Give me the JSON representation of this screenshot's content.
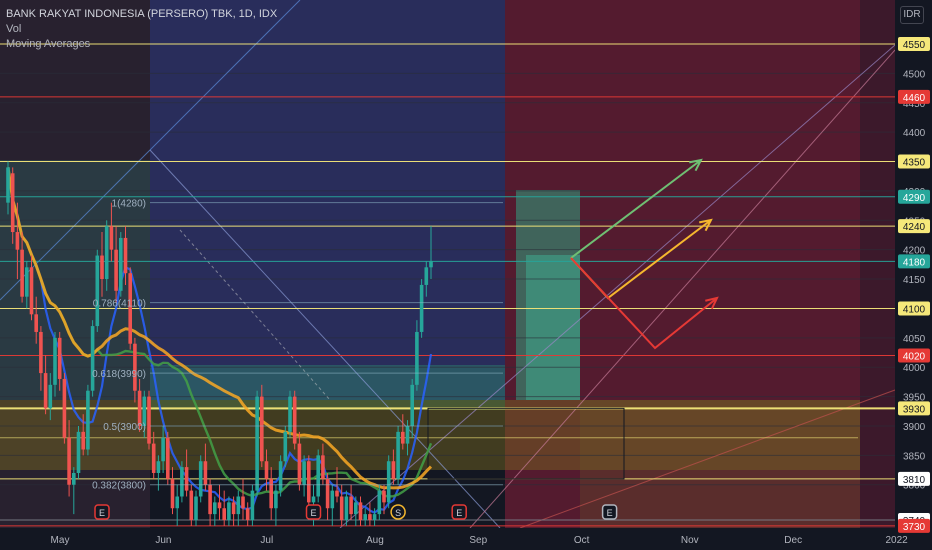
{
  "legend": {
    "symbol": "BANK RAKYAT INDONESIA (PERSERO) TBK, 1D, IDX",
    "indicator_1": "Vol",
    "indicator_2": "Moving Averages"
  },
  "currency": "IDR",
  "chart_data": {
    "type": "candlestick",
    "y_range": [
      3730,
      4610
    ],
    "y_ticks": [
      3800,
      3850,
      3900,
      3950,
      4000,
      4050,
      4100,
      4150,
      4200,
      4250,
      4300,
      4350,
      4400,
      4450,
      4500
    ],
    "x_labels": [
      {
        "label": "May",
        "x": 0
      },
      {
        "label": "Jun",
        "x": 22
      },
      {
        "label": "Jul",
        "x": 44
      },
      {
        "label": "Aug",
        "x": 67
      },
      {
        "label": "Sep",
        "x": 89
      },
      {
        "label": "Oct",
        "x": 111
      },
      {
        "label": "Nov",
        "x": 134
      },
      {
        "label": "Dec",
        "x": 156
      },
      {
        "label": "2022",
        "x": 178
      }
    ],
    "candles": [
      [
        4280,
        4350,
        4260,
        4340
      ],
      [
        4330,
        4340,
        4210,
        4230
      ],
      [
        4230,
        4280,
        4150,
        4200
      ],
      [
        4200,
        4230,
        4110,
        4120
      ],
      [
        4120,
        4180,
        4100,
        4170
      ],
      [
        4170,
        4190,
        4080,
        4090
      ],
      [
        4090,
        4120,
        4040,
        4060
      ],
      [
        4060,
        4070,
        3960,
        3990
      ],
      [
        3990,
        4020,
        3920,
        3930
      ],
      [
        3930,
        3990,
        3910,
        3970
      ],
      [
        3970,
        4060,
        3950,
        4050
      ],
      [
        4050,
        4060,
        3960,
        3980
      ],
      [
        3980,
        3990,
        3870,
        3880
      ],
      [
        3880,
        3910,
        3780,
        3800
      ],
      [
        3800,
        3830,
        3750,
        3820
      ],
      [
        3820,
        3900,
        3810,
        3890
      ],
      [
        3890,
        3920,
        3850,
        3860
      ],
      [
        3860,
        3970,
        3850,
        3960
      ],
      [
        3960,
        4080,
        3950,
        4070
      ],
      [
        4070,
        4200,
        4060,
        4190
      ],
      [
        4190,
        4230,
        4120,
        4150
      ],
      [
        4150,
        4250,
        4130,
        4240
      ],
      [
        4240,
        4280,
        4180,
        4200
      ],
      [
        4200,
        4240,
        4110,
        4130
      ],
      [
        4130,
        4230,
        4120,
        4220
      ],
      [
        4220,
        4240,
        4140,
        4160
      ],
      [
        4160,
        4170,
        4030,
        4040
      ],
      [
        4040,
        4050,
        3940,
        3960
      ],
      [
        3960,
        3980,
        3890,
        3900
      ],
      [
        3900,
        3960,
        3880,
        3950
      ],
      [
        3950,
        3960,
        3860,
        3870
      ],
      [
        3870,
        3890,
        3810,
        3820
      ],
      [
        3820,
        3850,
        3790,
        3840
      ],
      [
        3840,
        3900,
        3820,
        3880
      ],
      [
        3880,
        3890,
        3800,
        3810
      ],
      [
        3810,
        3830,
        3750,
        3760
      ],
      [
        3760,
        3800,
        3730,
        3780
      ],
      [
        3780,
        3840,
        3770,
        3830
      ],
      [
        3830,
        3860,
        3780,
        3790
      ],
      [
        3790,
        3800,
        3730,
        3740
      ],
      [
        3740,
        3790,
        3730,
        3780
      ],
      [
        3780,
        3850,
        3770,
        3840
      ],
      [
        3840,
        3870,
        3790,
        3800
      ],
      [
        3800,
        3810,
        3730,
        3750
      ],
      [
        3750,
        3780,
        3730,
        3770
      ],
      [
        3770,
        3800,
        3740,
        3760
      ],
      [
        3760,
        3790,
        3730,
        3740
      ],
      [
        3740,
        3780,
        3730,
        3770
      ],
      [
        3770,
        3780,
        3730,
        3750
      ],
      [
        3750,
        3790,
        3730,
        3780
      ],
      [
        3780,
        3810,
        3740,
        3760
      ],
      [
        3760,
        3770,
        3730,
        3740
      ],
      [
        3740,
        3800,
        3730,
        3790
      ],
      [
        3790,
        3960,
        3780,
        3950
      ],
      [
        3950,
        3970,
        3830,
        3840
      ],
      [
        3840,
        3860,
        3790,
        3810
      ],
      [
        3810,
        3830,
        3740,
        3760
      ],
      [
        3760,
        3800,
        3730,
        3790
      ],
      [
        3790,
        3850,
        3780,
        3840
      ],
      [
        3840,
        3900,
        3830,
        3890
      ],
      [
        3890,
        3960,
        3880,
        3950
      ],
      [
        3950,
        3960,
        3860,
        3870
      ],
      [
        3870,
        3890,
        3790,
        3800
      ],
      [
        3800,
        3850,
        3780,
        3840
      ],
      [
        3840,
        3850,
        3760,
        3770
      ],
      [
        3770,
        3800,
        3730,
        3780
      ],
      [
        3780,
        3860,
        3770,
        3850
      ],
      [
        3850,
        3870,
        3800,
        3810
      ],
      [
        3810,
        3820,
        3740,
        3760
      ],
      [
        3760,
        3800,
        3730,
        3790
      ],
      [
        3790,
        3830,
        3770,
        3780
      ],
      [
        3780,
        3800,
        3730,
        3740
      ],
      [
        3740,
        3790,
        3730,
        3780
      ],
      [
        3780,
        3800,
        3740,
        3750
      ],
      [
        3750,
        3780,
        3730,
        3770
      ],
      [
        3770,
        3780,
        3730,
        3740
      ],
      [
        3740,
        3760,
        3730,
        3750
      ],
      [
        3750,
        3770,
        3730,
        3740
      ],
      [
        3740,
        3760,
        3730,
        3750
      ],
      [
        3750,
        3800,
        3740,
        3790
      ],
      [
        3790,
        3800,
        3750,
        3770
      ],
      [
        3770,
        3850,
        3760,
        3840
      ],
      [
        3840,
        3860,
        3800,
        3810
      ],
      [
        3810,
        3900,
        3800,
        3890
      ],
      [
        3890,
        3920,
        3860,
        3870
      ],
      [
        3870,
        3910,
        3850,
        3900
      ],
      [
        3900,
        3980,
        3880,
        3970
      ],
      [
        3970,
        4080,
        3960,
        4060
      ],
      [
        4060,
        4150,
        4050,
        4140
      ],
      [
        4140,
        4180,
        4120,
        4170
      ],
      [
        4170,
        4240,
        4150,
        4180
      ]
    ],
    "levels": [
      {
        "price": 4550,
        "color": "#f5e87a",
        "label": "4550",
        "label_bg": "#f5e87a",
        "label_fg": "#131722"
      },
      {
        "price": 4460,
        "color": "#e53935",
        "label": "4460",
        "label_bg": "#e53935",
        "label_fg": "#ffffff"
      },
      {
        "price": 4350,
        "color": "#f5e87a",
        "label": "4350",
        "label_bg": "#f5e87a",
        "label_fg": "#131722"
      },
      {
        "price": 4290,
        "color": "#26a69a",
        "label": "4290",
        "label_bg": "#26a69a",
        "label_fg": "#ffffff"
      },
      {
        "price": 4240,
        "color": "#f5e87a",
        "label": "4240",
        "label_bg": "#f5e87a",
        "label_fg": "#131722"
      },
      {
        "price": 4180,
        "color": "#26a69a",
        "label": "4180",
        "label_bg": "#26a69a",
        "label_fg": "#ffffff"
      },
      {
        "price": 4100,
        "color": "#f5e87a",
        "label": "4100",
        "label_bg": "#f5e87a",
        "label_fg": "#131722"
      },
      {
        "price": 4020,
        "color": "#e53935",
        "label": "4020",
        "label_bg": "#e53935",
        "label_fg": "#ffffff"
      },
      {
        "price": 3930,
        "color": "#f5e87a",
        "label": "3930",
        "label_bg": "#f5e87a",
        "label_fg": "#131722"
      },
      {
        "price": 3810,
        "color": "#f5e87a",
        "label": "3810",
        "label_bg": "#ffffff",
        "label_fg": "#131722"
      },
      {
        "price": 3740,
        "color": "#787b86",
        "label": "3740",
        "label_bg": "#ffffff",
        "label_fg": "#131722"
      },
      {
        "price": 3730,
        "color": "#e53935",
        "label": "3730",
        "label_bg": "#e53935",
        "label_fg": "#ffffff"
      }
    ],
    "fib_levels": [
      {
        "text": "1(4280)",
        "price": 4280
      },
      {
        "text": "0.786(4110)",
        "price": 4110
      },
      {
        "text": "0.618(3990)",
        "price": 3990
      },
      {
        "text": "0.5(3900)",
        "price": 3900
      },
      {
        "text": "0.382(3800)",
        "price": 3800
      }
    ],
    "event_markers": [
      {
        "text": "E",
        "x": 20
      },
      {
        "text": "E",
        "x": 65
      },
      {
        "text": "S",
        "x": 83
      },
      {
        "text": "E",
        "x": 96
      },
      {
        "text": "E",
        "x": 128
      }
    ],
    "colors": {
      "up": "#26a69a",
      "down": "#ef5350",
      "ma_short": "#2962ff",
      "ma_mid": "#43a047",
      "ma_long": "#f9a825"
    }
  }
}
